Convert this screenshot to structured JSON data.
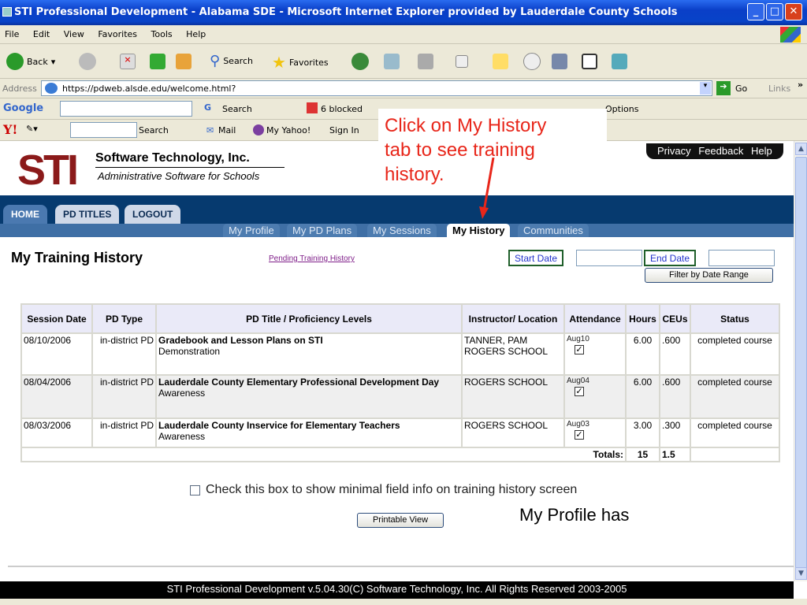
{
  "window": {
    "title": "STI Professional Development - Alabama SDE - Microsoft Internet Explorer provided by Lauderdale County Schools"
  },
  "menu": [
    "File",
    "Edit",
    "View",
    "Favorites",
    "Tools",
    "Help"
  ],
  "toolbar": {
    "back": "Back",
    "search": "Search",
    "favorites": "Favorites"
  },
  "address": {
    "label": "Address",
    "url": "https://pdweb.alsde.edu/welcome.html?",
    "go": "Go",
    "links": "Links"
  },
  "google": {
    "logo": "Google",
    "search": "Search",
    "blocked": "6 blocked",
    "options": "Options"
  },
  "yahoo": {
    "logo": "Y!",
    "search": "Search",
    "mail": "Mail",
    "myyahoo": "My Yahoo!",
    "signin": "Sign In"
  },
  "callout": {
    "line1": "Click on My History",
    "line2": "tab to see training",
    "line3": "history."
  },
  "header": {
    "logo": "STI",
    "company": "Software Technology, Inc.",
    "tagline": "Administrative Software for Schools",
    "links": [
      "Privacy",
      "Feedback",
      "Help"
    ]
  },
  "tabs": [
    "HOME",
    "PD TITLES",
    "LOGOUT"
  ],
  "subtabs": [
    "My Profile",
    "My PD Plans",
    "My Sessions",
    "My History",
    "Communities"
  ],
  "page": {
    "title": "My Training History",
    "pending_link": "Pending Training History",
    "start_date": "Start Date",
    "end_date": "End Date",
    "filter": "Filter by Date Range"
  },
  "table": {
    "headers": [
      "Session Date",
      "PD Type",
      "PD Title / Proficiency Levels",
      "Instructor/ Location",
      "Attendance",
      "Hours",
      "CEUs",
      "Status"
    ],
    "rows": [
      {
        "date": "08/10/2006",
        "type": "in-district PD",
        "title": "Gradebook and Lesson Plans on STI",
        "level": "Demonstration",
        "instructor": "TANNER, PAM",
        "location": "ROGERS SCHOOL",
        "att": "Aug10",
        "hours": "6.00",
        "ceus": ".600",
        "status": "completed course"
      },
      {
        "date": "08/04/2006",
        "type": "in-district PD",
        "title": "Lauderdale County Elementary Professional Development Day",
        "level": "Awareness",
        "instructor": "",
        "location": "ROGERS SCHOOL",
        "att": "Aug04",
        "hours": "6.00",
        "ceus": ".600",
        "status": "completed course"
      },
      {
        "date": "08/03/2006",
        "type": "in-district PD",
        "title": "Lauderdale County Inservice for Elementary Teachers",
        "level": "Awareness",
        "instructor": "",
        "location": "ROGERS SCHOOL",
        "att": "Aug03",
        "hours": "3.00",
        "ceus": ".300",
        "status": "completed course"
      }
    ],
    "totals_label": "Totals:",
    "total_hours": "15",
    "total_ceus": "1.5"
  },
  "minimal_checkbox": "Check this box to show minimal field info on training history screen",
  "printable": "Printable View",
  "annotation": "My Profile has",
  "footer": "STI Professional Development v.5.04.30(C) Software Technology, Inc. All Rights Reserved 2003-2005"
}
